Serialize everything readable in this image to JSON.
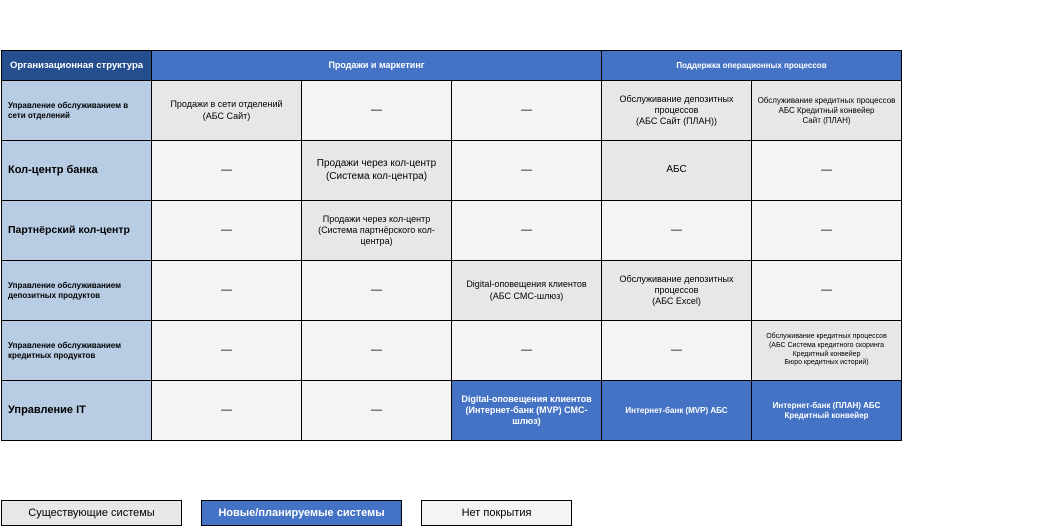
{
  "headers": {
    "org": "Организационная структура",
    "sales": "Продажи и маркетинг",
    "ops": "Поддержка операционных процессов"
  },
  "rows": [
    {
      "label": "Управление обслуживанием в сети отделений",
      "cells": [
        {
          "text": "Продажи в сети отделений\n(АБС Сайт)",
          "type": "existing"
        },
        {
          "text": "—",
          "type": "none"
        },
        {
          "text": "—",
          "type": "none"
        },
        {
          "text": "Обслуживание депозитных процессов\n(АБС Сайт (ПЛАН))",
          "type": "existing"
        },
        {
          "text": "Обслуживание кредитных процессов\nАБС Кредитный конвейер\nСайт (ПЛАН)",
          "type": "existing"
        }
      ]
    },
    {
      "label": "Кол-центр банка",
      "cells": [
        {
          "text": "—",
          "type": "none"
        },
        {
          "text": "Продажи через кол-центр\n(Система кол-центра)",
          "type": "existing"
        },
        {
          "text": "—",
          "type": "none"
        },
        {
          "text": "АБС",
          "type": "existing"
        },
        {
          "text": "—",
          "type": "none"
        }
      ]
    },
    {
      "label": "Партнёрский кол-центр",
      "cells": [
        {
          "text": "—",
          "type": "none"
        },
        {
          "text": "Продажи через кол-центр\n(Система партнёрского кол-центра)",
          "type": "existing"
        },
        {
          "text": "—",
          "type": "none"
        },
        {
          "text": "—",
          "type": "none"
        },
        {
          "text": "—",
          "type": "none"
        }
      ]
    },
    {
      "label": "Управление обслуживанием депозитных продуктов",
      "cells": [
        {
          "text": "—",
          "type": "none"
        },
        {
          "text": "—",
          "type": "none"
        },
        {
          "text": "Digital-оповещения клиентов\n(АБС СМС-шлюз)",
          "type": "existing"
        },
        {
          "text": "Обслуживание депозитных процессов\n(АБС Excel)",
          "type": "existing"
        },
        {
          "text": "—",
          "type": "none"
        }
      ]
    },
    {
      "label": "Управление обслуживанием кредитных продуктов",
      "cells": [
        {
          "text": "—",
          "type": "none"
        },
        {
          "text": "—",
          "type": "none"
        },
        {
          "text": "—",
          "type": "none"
        },
        {
          "text": "—",
          "type": "none"
        },
        {
          "text": "Обслуживание кредитных процессов\n(АБС Система кредитного скоринга\nКредитный конвейер\nБюро кредитных историй)",
          "type": "existing"
        }
      ]
    },
    {
      "label": "Управление IT",
      "cells": [
        {
          "text": "—",
          "type": "none"
        },
        {
          "text": "—",
          "type": "none"
        },
        {
          "text": "Digital-оповещения клиентов\n(Интернет-банк (MVP) СМС-шлюз)",
          "type": "new"
        },
        {
          "text": "Интернет-банк (MVP) АБС",
          "type": "new"
        },
        {
          "text": "Интернет-банк (ПЛАН) АБС\nКредитный конвейер",
          "type": "new"
        }
      ]
    }
  ],
  "legend": {
    "existing": "Существующие системы",
    "new": "Новые/планируемые системы",
    "none": "Нет покрытия"
  },
  "colors": {
    "header": "#4472c4",
    "org_header": "#254e8f",
    "row_label": "#b8cce4",
    "existing": "#e7e7e7",
    "new": "#4472c4",
    "none": "#f4f4f4"
  }
}
